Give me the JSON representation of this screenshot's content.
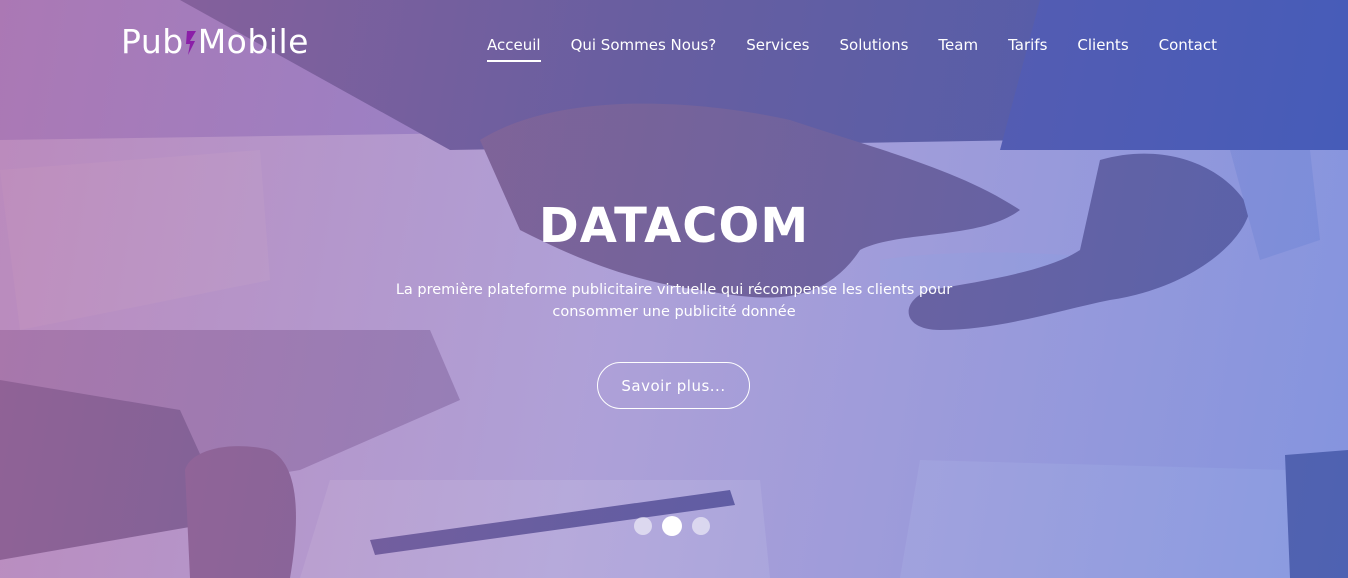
{
  "header": {
    "logo": {
      "part1": "Pub",
      "part2": "Mobile",
      "accent_color": "#8b1fa8"
    },
    "nav": [
      {
        "label": "Acceuil",
        "active": true
      },
      {
        "label": "Qui Sommes Nous?",
        "active": false
      },
      {
        "label": "Services",
        "active": false
      },
      {
        "label": "Solutions",
        "active": false
      },
      {
        "label": "Team",
        "active": false
      },
      {
        "label": "Tarifs",
        "active": false
      },
      {
        "label": "Clients",
        "active": false
      },
      {
        "label": "Contact",
        "active": false
      }
    ]
  },
  "hero": {
    "title": "DATACOM",
    "subtitle": "La première plateforme publicitaire virtuelle qui récompense les clients pour consommer une publicité donnée",
    "cta_label": "Savoir plus...",
    "slides": {
      "count": 3,
      "active_index": 1
    }
  },
  "colors": {
    "gradient_left": "#b06eaa",
    "gradient_right": "#506ed7",
    "text": "#ffffff"
  }
}
